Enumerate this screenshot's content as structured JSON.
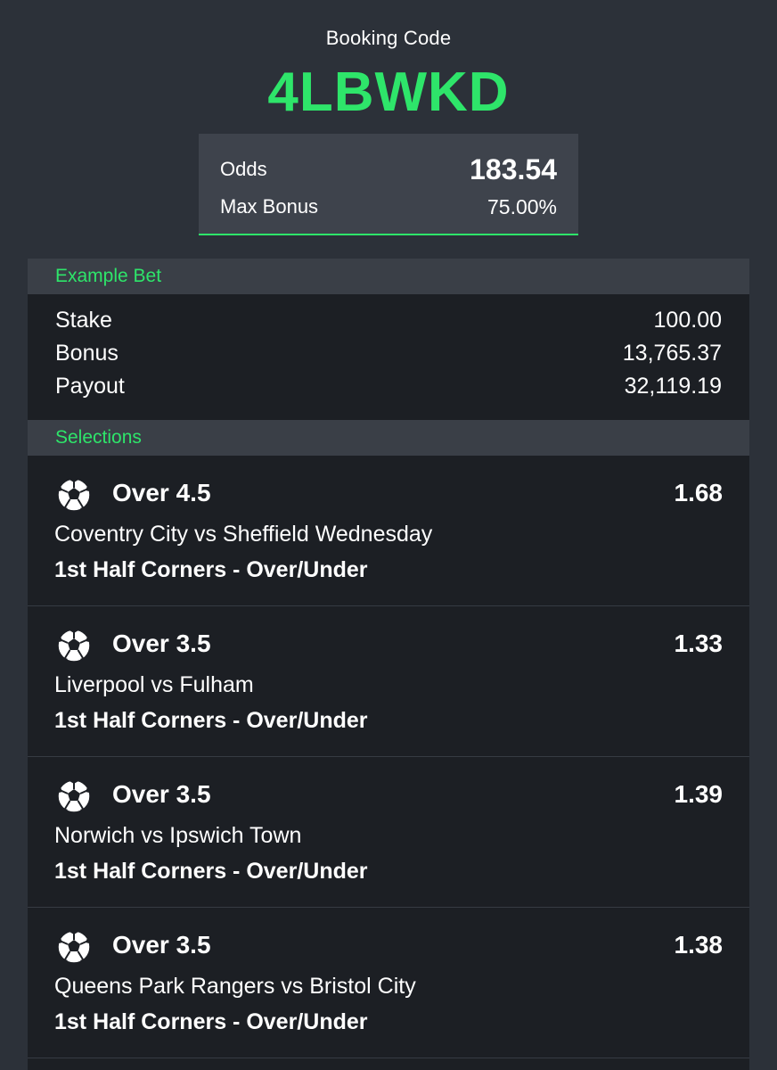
{
  "booking": {
    "label": "Booking Code",
    "code": "4LBWKD"
  },
  "summary": {
    "odds_label": "Odds",
    "odds_value": "183.54",
    "max_bonus_label": "Max Bonus",
    "max_bonus_value": "75.00%"
  },
  "example_bet": {
    "heading": "Example Bet",
    "rows": [
      {
        "label": "Stake",
        "value": "100.00"
      },
      {
        "label": "Bonus",
        "value": "13,765.37"
      },
      {
        "label": "Payout",
        "value": "32,119.19"
      }
    ]
  },
  "selections": {
    "heading": "Selections",
    "items": [
      {
        "pick": "Over 4.5",
        "odds": "1.68",
        "match": "Coventry City vs Sheffield Wednesday",
        "market": "1st Half Corners - Over/Under",
        "icon": "soccer-ball-icon"
      },
      {
        "pick": "Over 3.5",
        "odds": "1.33",
        "match": "Liverpool vs Fulham",
        "market": "1st Half Corners - Over/Under",
        "icon": "soccer-ball-icon"
      },
      {
        "pick": "Over 3.5",
        "odds": "1.39",
        "match": "Norwich vs Ipswich Town",
        "market": "1st Half Corners - Over/Under",
        "icon": "soccer-ball-icon"
      },
      {
        "pick": "Over 3.5",
        "odds": "1.38",
        "match": "Queens Park Rangers vs Bristol City",
        "market": "1st Half Corners - Over/Under",
        "icon": "soccer-ball-icon"
      }
    ]
  },
  "colors": {
    "background": "#2c3139",
    "accent_green": "#2ee56a",
    "panel_dark": "#1c1f24",
    "section_header": "#3a3f47",
    "odds_box": "#3e434c"
  }
}
